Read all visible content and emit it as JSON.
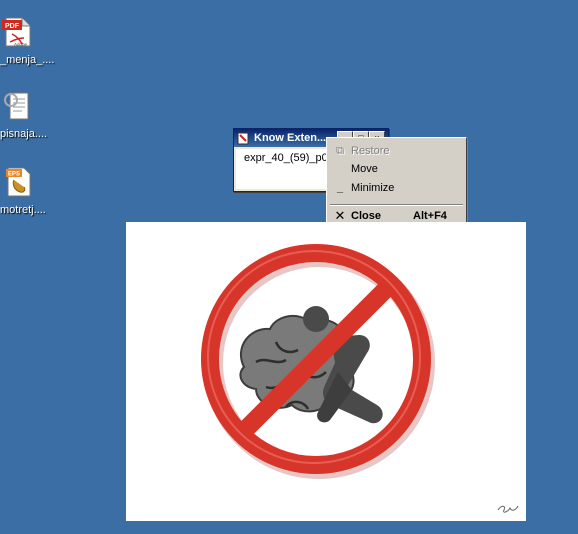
{
  "desktop": {
    "icons": [
      {
        "label": "_menja_....",
        "icon": "pdf-document-icon",
        "badge": "PDF",
        "sub": "Adobe"
      },
      {
        "label": "pisnaja....",
        "icon": "text-document-icon"
      },
      {
        "label": "motretj....",
        "icon": "eps-document-icon",
        "badge": "EPS"
      }
    ]
  },
  "window": {
    "title": "Know Exten...",
    "file": "expr_40_(59)_p0"
  },
  "context_menu": {
    "items": [
      {
        "label": "Restore",
        "icon": "restore-icon",
        "enabled": false
      },
      {
        "label": "Move",
        "enabled": true
      },
      {
        "label": "Minimize",
        "icon": "minimize-icon",
        "enabled": true
      },
      {
        "label": "Close",
        "accel": "Alt+F4",
        "icon": "close-icon",
        "enabled": true,
        "bold": true
      }
    ]
  },
  "picture": {
    "subject": "no-brain-pushing-sign",
    "colors": {
      "ring": "#d8352a",
      "figure": "#4a4a4a",
      "brain": "#6a6a6a"
    }
  }
}
